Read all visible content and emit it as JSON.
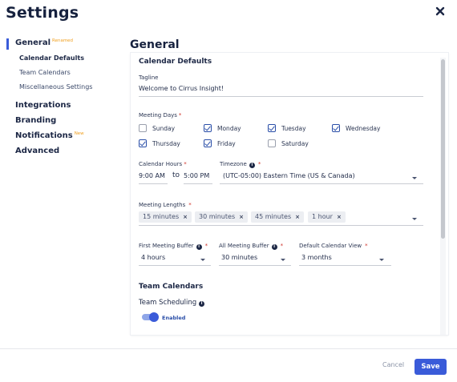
{
  "header": {
    "title": "Settings",
    "close_icon": "close-icon"
  },
  "sidebar": {
    "items": [
      {
        "label": "General",
        "badge": "Renamed"
      },
      {
        "label": "Integrations"
      },
      {
        "label": "Branding"
      },
      {
        "label": "Notifications",
        "badge": "New"
      },
      {
        "label": "Advanced"
      }
    ],
    "subitems": [
      "Calendar Defaults",
      "Team Calendars",
      "Miscellaneous Settings"
    ]
  },
  "main": {
    "title": "General",
    "calendar_defaults": {
      "title": "Calendar Defaults",
      "tagline_label": "Tagline",
      "tagline_value": "Welcome to Cirrus Insight!",
      "meeting_days_label": "Meeting Days",
      "days": [
        {
          "label": "Sunday",
          "checked": false
        },
        {
          "label": "Monday",
          "checked": true
        },
        {
          "label": "Tuesday",
          "checked": true
        },
        {
          "label": "Wednesday",
          "checked": true
        },
        {
          "label": "Thursday",
          "checked": true
        },
        {
          "label": "Friday",
          "checked": true
        },
        {
          "label": "Saturday",
          "checked": false
        }
      ],
      "calendar_hours_label": "Calendar Hours",
      "hours_start": "9:00 AM",
      "hours_to": "to",
      "hours_end": "5:00 PM",
      "timezone_label": "Timezone",
      "timezone_value": "(UTC-05:00) Eastern Time (US & Canada)",
      "meeting_lengths_label": "Meeting Lengths",
      "meeting_lengths": [
        "15 minutes",
        "30 minutes",
        "45 minutes",
        "1 hour"
      ],
      "first_buffer_label": "First Meeting Buffer",
      "first_buffer_value": "4 hours",
      "all_buffer_label": "All Meeting Buffer",
      "all_buffer_value": "30 minutes",
      "default_view_label": "Default Calendar View",
      "default_view_value": "3 months"
    },
    "team_calendars": {
      "title": "Team Calendars",
      "team_scheduling_label": "Team Scheduling",
      "toggle_label": "Enabled",
      "toggle_on": true
    }
  },
  "footer": {
    "cancel_label": "Cancel",
    "save_label": "Save"
  },
  "colors": {
    "accent": "#3a5bd9",
    "badge": "#f0a020",
    "required": "#d0342c"
  }
}
